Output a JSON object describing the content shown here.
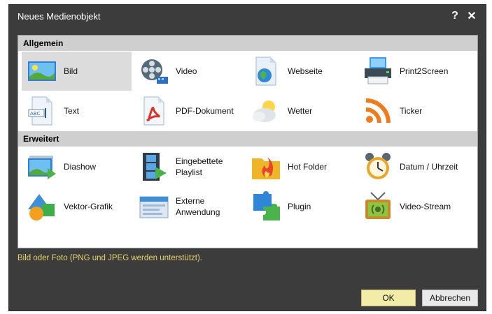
{
  "window": {
    "title": "Neues Medienobjekt",
    "help_icon": "?",
    "close_icon": "✕"
  },
  "sections": [
    {
      "label": "Allgemein",
      "items": [
        {
          "label": "Bild",
          "icon": "image-icon",
          "selected": true
        },
        {
          "label": "Video",
          "icon": "film-reel-icon"
        },
        {
          "label": "Webseite",
          "icon": "web-page-icon"
        },
        {
          "label": "Print2Screen",
          "icon": "printer-icon"
        },
        {
          "label": "Text",
          "icon": "text-document-icon"
        },
        {
          "label": "PDF-Dokument",
          "icon": "pdf-icon"
        },
        {
          "label": "Wetter",
          "icon": "weather-cloud-icon"
        },
        {
          "label": "Ticker",
          "icon": "rss-icon"
        }
      ]
    },
    {
      "label": "Erweitert",
      "items": [
        {
          "label": "Diashow",
          "icon": "slideshow-icon"
        },
        {
          "label": "Eingebettete Playlist",
          "icon": "playlist-icon"
        },
        {
          "label": "Hot Folder",
          "icon": "hot-folder-icon"
        },
        {
          "label": "Datum / Uhrzeit",
          "icon": "alarm-clock-icon"
        },
        {
          "label": "Vektor-Grafik",
          "icon": "vector-shapes-icon"
        },
        {
          "label": "Externe Anwendung",
          "icon": "application-window-icon"
        },
        {
          "label": "Plugin",
          "icon": "puzzle-icon"
        },
        {
          "label": "Video-Stream",
          "icon": "tv-stream-icon"
        }
      ]
    }
  ],
  "status_text": "Bild oder Foto (PNG und JPEG werden unterstützt).",
  "buttons": {
    "ok": "OK",
    "cancel": "Abbrechen"
  },
  "colors": {
    "dialog_background": "#3c3c3c",
    "section_header": "#cfcfcf",
    "selected_item": "#dcdcdc",
    "status_text": "#e6d36c",
    "ok_button": "#f2eca8"
  }
}
